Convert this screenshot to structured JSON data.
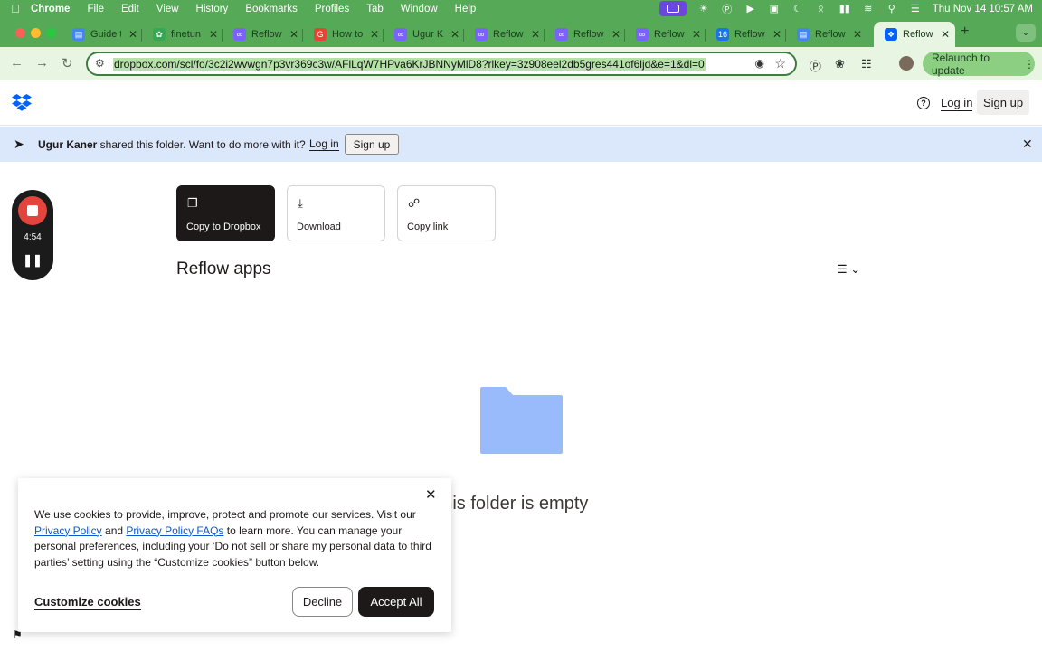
{
  "menubar": {
    "app": "Chrome",
    "items": [
      "File",
      "Edit",
      "View",
      "History",
      "Bookmarks",
      "Profiles",
      "Tab",
      "Window",
      "Help"
    ],
    "datetime": "Thu Nov 14  10:57 AM"
  },
  "tabs": [
    {
      "title": "Guide t",
      "favicon": "docs-icon",
      "color": "#4285f4"
    },
    {
      "title": "finetun",
      "favicon": "leaf-icon",
      "color": "#34a853"
    },
    {
      "title": "Reflow",
      "favicon": "reflow-icon",
      "color": "#7b61ff"
    },
    {
      "title": "How to",
      "favicon": "google-icon",
      "color": "#ea4335"
    },
    {
      "title": "Ugur K",
      "favicon": "reflow-icon",
      "color": "#7b61ff"
    },
    {
      "title": "Reflow",
      "favicon": "reflow-icon",
      "color": "#7b61ff"
    },
    {
      "title": "Reflow",
      "favicon": "reflow-icon",
      "color": "#7b61ff"
    },
    {
      "title": "Reflow",
      "favicon": "reflow-icon",
      "color": "#7b61ff"
    },
    {
      "title": "Reflow",
      "favicon": "calendar-icon",
      "color": "#1a73e8"
    },
    {
      "title": "Reflow",
      "favicon": "docs-icon",
      "color": "#4285f4"
    },
    {
      "title": "Reflow",
      "favicon": "dropbox-icon",
      "color": "#0061fe"
    }
  ],
  "toolbar": {
    "url": "dropbox.com/scl/fo/3c2i2wvwgn7p3vr369c3w/AFlLqW7HPva6KrJBNNyMlD8?rlkey=3z908eel2db5gres441of6ljd&e=1&dl=0",
    "relaunch_label": "Relaunch to update"
  },
  "header": {
    "login": "Log in",
    "signup": "Sign up"
  },
  "banner": {
    "owner": "Ugur Kaner",
    "message": " shared this folder. Want to do more with it?",
    "login": "Log in",
    "signup": "Sign up"
  },
  "recorder": {
    "time": "4:54"
  },
  "actions": {
    "copy": "Copy to Dropbox",
    "download": "Download",
    "copy_link": "Copy link"
  },
  "folder": {
    "title": "Reflow apps",
    "empty_text": "This folder is empty"
  },
  "cookie": {
    "text_1": "We use cookies to provide, improve, protect and promote our services. Visit our ",
    "link_1": "Privacy Policy",
    "text_2": " and ",
    "link_2": "Privacy Policy FAQs",
    "text_3": " to learn more. You can manage your personal preferences, including your ‘Do not sell or share my personal data to third parties’ setting using the “Customize cookies” button below.",
    "customize": "Customize cookies",
    "decline": "Decline",
    "accept": "Accept All"
  },
  "colors": {
    "chrome_frame": "#56a957",
    "toolbar_bg": "#e8f5e3",
    "banner_bg": "#dbe7fb",
    "folder_blue": "#99bbfb",
    "dropbox_blue": "#0061fe",
    "record_red": "#e5443d"
  }
}
